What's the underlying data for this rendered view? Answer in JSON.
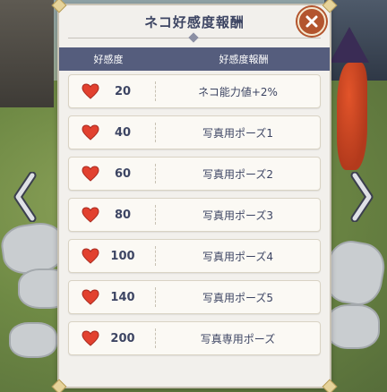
{
  "dialog": {
    "title": "ネコ好感度報酬",
    "columns": {
      "affection": "好感度",
      "reward": "好感度報酬"
    }
  },
  "rewards": [
    {
      "affection": "20",
      "reward": "ネコ能力値+2%"
    },
    {
      "affection": "40",
      "reward": "写真用ポーズ1"
    },
    {
      "affection": "60",
      "reward": "写真用ポーズ2"
    },
    {
      "affection": "80",
      "reward": "写真用ポーズ3"
    },
    {
      "affection": "100",
      "reward": "写真用ポーズ4"
    },
    {
      "affection": "140",
      "reward": "写真用ポーズ5"
    },
    {
      "affection": "200",
      "reward": "写真専用ポーズ"
    }
  ],
  "icons": {
    "heart": "heart-icon",
    "close": "close-icon",
    "prev": "chevron-left-icon",
    "next": "chevron-right-icon"
  },
  "colors": {
    "header": "#555d7d",
    "heart": "#e2412f",
    "close": "#b3552e",
    "text": "#3d4563"
  }
}
